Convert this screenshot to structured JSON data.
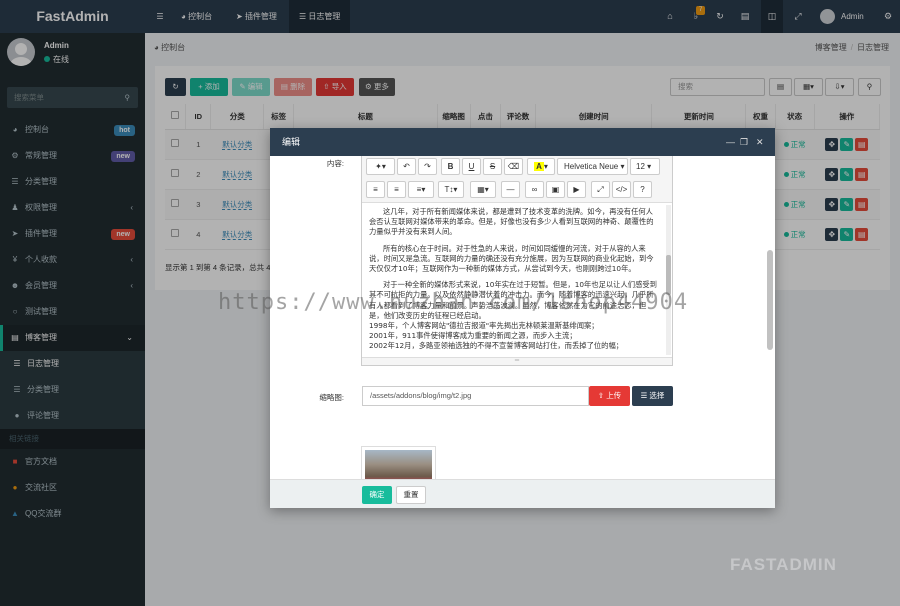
{
  "brand": "FastAdmin",
  "user": {
    "name": "Admin",
    "status": "在线"
  },
  "sidebar": {
    "search_placeholder": "搜索菜单",
    "items": [
      {
        "label": "控制台",
        "icon": "dashboard-icon",
        "badge": "hot",
        "badge_color": "#3c8dbc"
      },
      {
        "label": "常规管理",
        "icon": "cogs-icon",
        "badge": "new",
        "badge_color": "#605ca8"
      },
      {
        "label": "分类管理",
        "icon": "list-icon"
      },
      {
        "label": "权限管理",
        "icon": "group-icon",
        "caret": "‹"
      },
      {
        "label": "插件管理",
        "icon": "rocket-icon",
        "badge": "new",
        "badge_color": "#e74c3c"
      },
      {
        "label": "个人收款",
        "icon": "yen-icon",
        "caret": "‹"
      },
      {
        "label": "会员管理",
        "icon": "users-icon",
        "caret": "‹"
      },
      {
        "label": "测试管理",
        "icon": "circle-icon"
      },
      {
        "label": "博客管理",
        "icon": "blog-icon",
        "caret": "⌄",
        "active": true
      }
    ],
    "sub_items": [
      {
        "label": "日志管理",
        "current": true
      },
      {
        "label": "分类管理"
      },
      {
        "label": "评论管理"
      }
    ],
    "section": "相关链接",
    "links": [
      {
        "label": "官方文档",
        "color": "#e74c3c"
      },
      {
        "label": "交流社区",
        "color": "#f39c12"
      },
      {
        "label": "QQ交流群",
        "color": "#3c8dbc"
      }
    ]
  },
  "topbar": {
    "tabs": [
      "控制台",
      "插件管理",
      "日志管理"
    ],
    "notif_count": "7",
    "admin": "Admin"
  },
  "breadcrumb": {
    "home": "控制台",
    "path": [
      "博客管理",
      "日志管理"
    ]
  },
  "toolbar": {
    "add": "添加",
    "edit": "编辑",
    "delete": "删除",
    "import": "导入",
    "more": "更多",
    "search_placeholder": "搜索"
  },
  "table": {
    "headers": [
      "ID",
      "分类",
      "标题",
      "标题",
      "缩略图",
      "点击",
      "评论数",
      "创建时间",
      "更新时间",
      "权重",
      "状态",
      "操作"
    ],
    "rows": [
      {
        "id": "1",
        "category": "默认分类",
        "status": "正常"
      },
      {
        "id": "2",
        "category": "默认分类",
        "status": "正常"
      },
      {
        "id": "3",
        "category": "默认分类",
        "status": "正常"
      },
      {
        "id": "4",
        "category": "默认分类",
        "status": "正常"
      }
    ],
    "footer": "显示第 1 到第 4 条记录，总共 4"
  },
  "modal": {
    "title": "编辑",
    "content_label": "内容:",
    "font_name": "Helvetica Neue",
    "font_size": "12",
    "paragraphs": [
      "这几年，对于所有新闻媒体来说，都是遭到了技术变革的洗牌。如今，再没有任何人会否认互联网对媒体带来的革命。但是，好像也没有多少人看到互联网的神奇、颠覆性的力量似乎并没有来到人间。",
      "所有的核心在于时间。对于性急的人来说，时间如同缓慢的河流，对于从容的人来说，时间又是急流。互联网的力量的确还没有充分施展，因为互联网的商业化起始，到今天仅仅才10年；互联网作为一种新的媒体方式，从尝试到今天，也刚刚跨过10年。",
      "对于一种全新的媒体形式来说，10年实在过于短暂。但是，10年也足以让人们感受到其不可抗拒的力量。以及依然静静潜伏着的冲击力。而今，随着博客的迅速兴起，几乎所有人都看到了博客力量和前景。声势浩荡波澜。虽然，博客依然在为它的前途忐忑，但是，他们改变历史的征程已经启动。"
    ],
    "lines": [
      "1998年，个人博客网站\"德拉吉报道\"率先揭出克林顿莱温斯基绯闻案；",
      "2001年，911事件使得博客成为重要的新闻之源，而步入主流；",
      "2002年12月，多路亚领袖选独的不得不宣誓博客网站打住，而丢掉了位的幅；"
    ],
    "thumb_label": "缩略图:",
    "thumb_value": "/assets/addons/blog/img/t2.jpg",
    "upload": "上传",
    "choose": "选择",
    "ok": "确定",
    "reset": "重置"
  },
  "watermark": "https://www.huzhan.com/1shop44904",
  "watermark2": "FASTADMIN"
}
